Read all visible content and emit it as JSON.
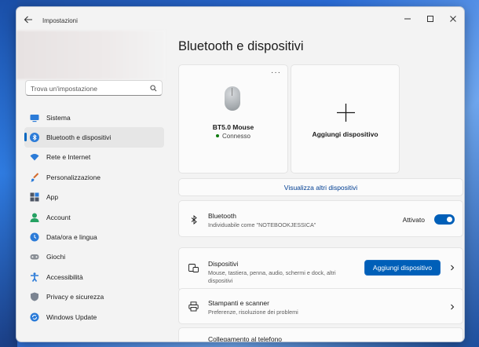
{
  "window": {
    "title": "Impostazioni"
  },
  "search": {
    "placeholder": "Trova un'impostazione"
  },
  "sidebar": {
    "items": [
      {
        "label": "Sistema",
        "icon": "monitor-icon"
      },
      {
        "label": "Bluetooth e dispositivi",
        "icon": "bluetooth-icon",
        "active": true
      },
      {
        "label": "Rete e Internet",
        "icon": "wifi-icon"
      },
      {
        "label": "Personalizzazione",
        "icon": "brush-icon"
      },
      {
        "label": "App",
        "icon": "apps-icon"
      },
      {
        "label": "Account",
        "icon": "person-icon"
      },
      {
        "label": "Data/ora e lingua",
        "icon": "clock-globe-icon"
      },
      {
        "label": "Giochi",
        "icon": "gamepad-icon"
      },
      {
        "label": "Accessibilità",
        "icon": "accessibility-icon"
      },
      {
        "label": "Privacy e sicurezza",
        "icon": "shield-icon"
      },
      {
        "label": "Windows Update",
        "icon": "update-icon"
      }
    ]
  },
  "main": {
    "title": "Bluetooth e dispositivi",
    "device_card": {
      "name": "BT5.0 Mouse",
      "status": "Connesso",
      "more": "···"
    },
    "add_card": {
      "label": "Aggiungi dispositivo"
    },
    "view_more": "Visualizza altri dispositivi",
    "bluetooth_row": {
      "title": "Bluetooth",
      "subtitle": "Individuabile come \"NOTEBOOKJESSICA\"",
      "toggle_label": "Attivato",
      "toggle_on": true
    },
    "devices_row": {
      "title": "Dispositivi",
      "subtitle": "Mouse, tastiera, penna, audio, schermi e dock, altri dispositivi",
      "button": "Aggiungi dispositivo"
    },
    "printers_row": {
      "title": "Stampanti e scanner",
      "subtitle": "Preferenze, risoluzione dei problemi"
    },
    "phone_row": {
      "title": "Collegamento al telefono"
    }
  },
  "colors": {
    "accent": "#005fb8",
    "status_green": "#0f7b0f",
    "link": "#003e92"
  }
}
